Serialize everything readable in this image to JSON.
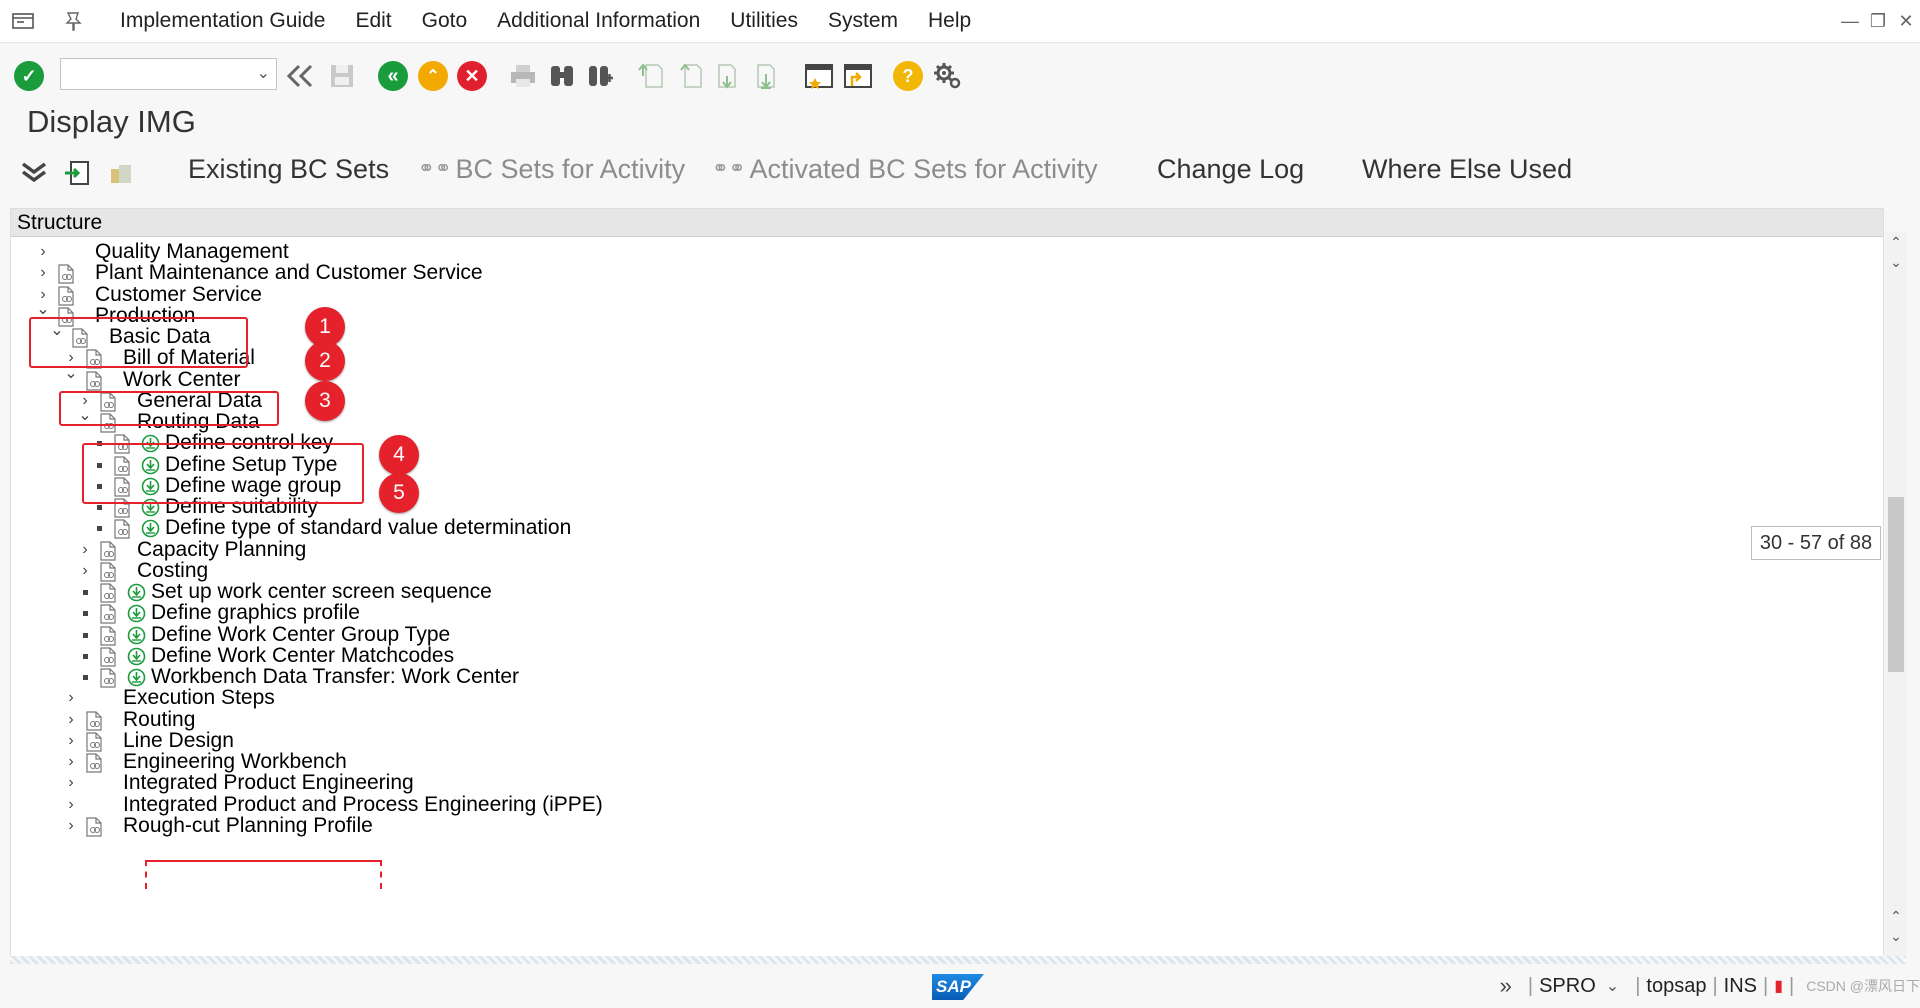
{
  "menubar": {
    "items": [
      "Implementation Guide",
      "Edit",
      "Goto",
      "Additional Information",
      "Utilities",
      "System",
      "Help"
    ]
  },
  "toolbar": {
    "command_value": "",
    "icons": [
      "enter-icon",
      "back-double-icon",
      "save-icon",
      "back-icon",
      "exit-icon",
      "cancel-icon",
      "print-icon",
      "find-icon",
      "find-next-icon",
      "first-page-icon",
      "previous-page-icon",
      "next-page-icon",
      "last-page-icon",
      "create-session-icon",
      "generate-shortcut-icon",
      "help-icon",
      "customize-layout-icon"
    ]
  },
  "title": "Display IMG",
  "app_toolbar": {
    "existing_bc_sets": "Existing BC Sets",
    "bc_sets_for_activity": "BC Sets for Activity",
    "activated_bc_sets": "Activated BC Sets for Activity",
    "change_log": "Change Log",
    "where_else_used": "Where Else Used"
  },
  "tree": {
    "header": "Structure",
    "rows": [
      {
        "label": "Quality Management",
        "level": 0,
        "type": "collapsed",
        "doc": false,
        "act": false
      },
      {
        "label": "Plant Maintenance and Customer Service",
        "level": 0,
        "type": "collapsed",
        "doc": true,
        "act": false
      },
      {
        "label": "Customer Service",
        "level": 0,
        "type": "collapsed",
        "doc": true,
        "act": false
      },
      {
        "label": "Production",
        "level": 0,
        "type": "expanded",
        "doc": true,
        "act": false
      },
      {
        "label": "Basic Data",
        "level": 1,
        "type": "expanded",
        "doc": true,
        "act": false
      },
      {
        "label": "Bill of Material",
        "level": 2,
        "type": "collapsed",
        "doc": true,
        "act": false
      },
      {
        "label": "Work Center",
        "level": 2,
        "type": "expanded",
        "doc": true,
        "act": false
      },
      {
        "label": "General Data",
        "level": 3,
        "type": "collapsed",
        "doc": true,
        "act": false
      },
      {
        "label": "Routing Data",
        "level": 3,
        "type": "expanded",
        "doc": true,
        "act": false
      },
      {
        "label": "Define control key",
        "level": 4,
        "type": "leaf",
        "doc": true,
        "act": true
      },
      {
        "label": "Define Setup Type",
        "level": 4,
        "type": "leaf",
        "doc": true,
        "act": true
      },
      {
        "label": "Define wage group",
        "level": 4,
        "type": "leaf",
        "doc": true,
        "act": true
      },
      {
        "label": "Define suitability",
        "level": 4,
        "type": "leaf",
        "doc": true,
        "act": true
      },
      {
        "label": "Define type of standard value determination",
        "level": 4,
        "type": "leaf",
        "doc": true,
        "act": true
      },
      {
        "label": "Capacity Planning",
        "level": 3,
        "type": "collapsed",
        "doc": true,
        "act": false
      },
      {
        "label": "Costing",
        "level": 3,
        "type": "collapsed",
        "doc": true,
        "act": false
      },
      {
        "label": "Set up work center screen sequence",
        "level": 3,
        "type": "leaf",
        "doc": true,
        "act": true
      },
      {
        "label": "Define graphics profile",
        "level": 3,
        "type": "leaf",
        "doc": true,
        "act": true
      },
      {
        "label": "Define Work Center Group Type",
        "level": 3,
        "type": "leaf",
        "doc": true,
        "act": true
      },
      {
        "label": "Define Work Center Matchcodes",
        "level": 3,
        "type": "leaf",
        "doc": true,
        "act": true
      },
      {
        "label": "Workbench Data Transfer: Work Center",
        "level": 3,
        "type": "leaf",
        "doc": true,
        "act": true
      },
      {
        "label": "Execution Steps",
        "level": 2,
        "type": "collapsed",
        "doc": false,
        "act": false
      },
      {
        "label": "Routing",
        "level": 2,
        "type": "collapsed",
        "doc": true,
        "act": false
      },
      {
        "label": "Line Design",
        "level": 2,
        "type": "collapsed",
        "doc": true,
        "act": false
      },
      {
        "label": "Engineering Workbench",
        "level": 2,
        "type": "collapsed",
        "doc": true,
        "act": false
      },
      {
        "label": "Integrated Product Engineering",
        "level": 2,
        "type": "collapsed",
        "doc": false,
        "act": false
      },
      {
        "label": "Integrated Product and Process Engineering (iPPE)",
        "level": 2,
        "type": "collapsed",
        "doc": false,
        "act": false
      },
      {
        "label": "Rough-cut Planning Profile",
        "level": 2,
        "type": "collapsed",
        "doc": true,
        "act": false
      }
    ]
  },
  "callouts": [
    "1",
    "2",
    "3",
    "4",
    "5"
  ],
  "range_tip": "30 - 57 of 88",
  "status": {
    "logo": "SAP",
    "transaction": "SPRO",
    "server": "topsap",
    "mode": "INS",
    "watermark": "CSDN @漂风日下"
  },
  "colors": {
    "accent_red": "#e5212b",
    "ok_green": "#1a9b3c",
    "help_yellow": "#f2b705"
  }
}
